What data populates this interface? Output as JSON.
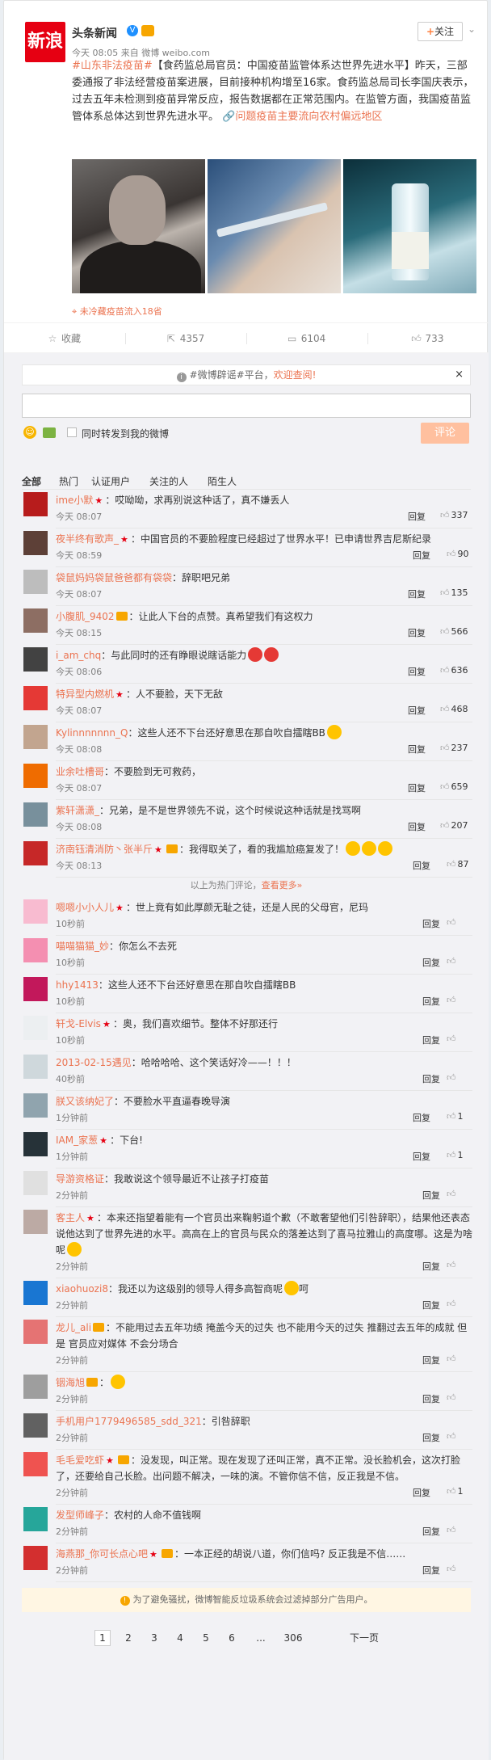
{
  "post": {
    "author": "头条新闻",
    "avatar_text": "新浪",
    "verified_icon": "V",
    "follow_plus": "+",
    "follow_label": "关注",
    "collapse_icon": "chevron-down-icon",
    "meta": "今天 08:05 来自 微博 weibo.com",
    "topic": "#山东非法疫苗#",
    "body": "【食药监总局官员：中国疫苗监管体系达世界先进水平】昨天，三部委通报了非法经营疫苗案进展，目前接种机构增至16家。食药监总局司长李国庆表示，过去五年未检测到疫苗异常反应，报告数据都在正常范围内。在监管方面，我国疫苗监管体系总体达到世界先进水平。",
    "link_icon": "link-icon",
    "link_text": "问题疫苗主要流向农村偏远地区",
    "location": "未冷藏疫苗流入18省"
  },
  "actions": {
    "collect": "收藏",
    "repost": "4357",
    "comment": "6104",
    "like": "733"
  },
  "comment_panel": {
    "notice_prefix": "#微博辟谣#平台，",
    "notice_link": "欢迎查阅!",
    "notice_close": "×",
    "emoji_icon": "smile-icon",
    "picture_icon": "picture-icon",
    "repost_check_label": "同时转发到我的微博",
    "post_button": "评论",
    "tabs": [
      "全部",
      "热门",
      "认证用户",
      "关注的人",
      "陌生人"
    ]
  },
  "comments": [
    {
      "user": "ime小默",
      "badges": "vip",
      "text": "：哎呦呦，求再别说这种话了，真不嫌丢人",
      "time": "今天 08:07",
      "reply": "回复",
      "likes": "337"
    },
    {
      "user": "夜半终有歌声_",
      "badges": "vip",
      "text": "：中国官员的不要脸程度已经超过了世界水平！已申请世界吉尼斯纪录",
      "time": "今天 08:59",
      "reply": "回复",
      "likes": "90"
    },
    {
      "user": "袋鼠妈妈袋鼠爸爸都有袋袋",
      "badges": "",
      "text": "：辞职吧兄弟",
      "time": "今天 08:07",
      "reply": "回复",
      "likes": "135"
    },
    {
      "user": "小腹肌_9402",
      "badges": "lv",
      "text": "：让此人下台的点赞。真希望我们有这权力",
      "time": "今天 08:15",
      "reply": "回复",
      "likes": "566"
    },
    {
      "user": "i_am_chq",
      "badges": "",
      "text": "：与此同时的还有睁眼说瞎话能力",
      "time": "今天 08:06",
      "reply": "回复",
      "likes": "636",
      "emoji": "red2"
    },
    {
      "user": "特异型内燃机",
      "badges": "vip",
      "text": "：人不要脸，天下无敌",
      "time": "今天 08:07",
      "reply": "回复",
      "likes": "468"
    },
    {
      "user": "Kylinnnnnnn_Q",
      "badges": "",
      "text": "：这些人还不下台还好意思在那自吹自擂瞎BB",
      "time": "今天 08:08",
      "reply": "回复",
      "likes": "237",
      "emoji": "one"
    },
    {
      "user": "业余吐槽哥",
      "badges": "",
      "text": "：不要脸到无可救药，",
      "time": "今天 08:07",
      "reply": "回复",
      "likes": "659"
    },
    {
      "user": "紫轩潇潇_",
      "badges": "",
      "text": "：兄弟，是不是世界领先不说，这个时候说这种话就是找骂啊",
      "time": "今天 08:08",
      "reply": "回复",
      "likes": "207"
    },
    {
      "user": "济南钰清消防丶张半斤",
      "badges": "vlv",
      "text": "：我得取关了，看的我尴尬癌复发了！",
      "time": "今天 08:13",
      "reply": "回复",
      "likes": "87",
      "emoji": "three"
    }
  ],
  "hot_note": {
    "prefix": "以上为热门评论，",
    "more": "查看更多»"
  },
  "latest": [
    {
      "user": "嗯嗯小小人儿",
      "badges": "vip",
      "text": "：世上竟有如此厚颜无耻之徒，还是人民的父母官，尼玛",
      "time": "10秒前",
      "reply": "回复",
      "likes": ""
    },
    {
      "user": "喵喵猫猫_妙",
      "badges": "",
      "text": "：你怎么不去死",
      "time": "10秒前",
      "reply": "回复",
      "likes": ""
    },
    {
      "user": "hhy1413",
      "badges": "",
      "text": "：这些人还不下台还好意思在那自吹自擂瞎BB",
      "time": "10秒前",
      "reply": "回复",
      "likes": ""
    },
    {
      "user": "轩戈-Elvis",
      "badges": "vip",
      "text": "：奥，我们喜欢细节。整体不好那还行",
      "time": "10秒前",
      "reply": "回复",
      "likes": ""
    },
    {
      "user": "2013-02-15遇见",
      "badges": "",
      "text": "：哈哈哈哈、这个笑话好冷——！！！",
      "time": "40秒前",
      "reply": "回复",
      "likes": ""
    },
    {
      "user": "朕又该纳妃了",
      "badges": "",
      "text": "：不要脸水平直逼春晚导演",
      "time": "1分钟前",
      "reply": "回复",
      "likes": "1"
    },
    {
      "user": "IAM_家葱",
      "badges": "vip",
      "text": "：下台!",
      "time": "1分钟前",
      "reply": "回复",
      "likes": "1"
    },
    {
      "user": "导游资格证",
      "badges": "",
      "text": "：我敢说这个领导最近不让孩子打疫苗",
      "time": "2分钟前",
      "reply": "回复",
      "likes": ""
    },
    {
      "user": "客主人",
      "badges": "vip",
      "text": "：本来还指望着能有一个官员出来鞠躬道个歉（不敢奢望他们引咎辞职），结果他还表态说他达到了世界先进的水平。高高在上的官员与民众的落差达到了喜马拉雅山的高度哪。这是为啥呢",
      "time": "2分钟前",
      "reply": "回复",
      "likes": "",
      "emoji": "one"
    },
    {
      "user": "xiaohuozi8",
      "badges": "",
      "text": "：我还以为这级别的领导人得多高智商呢",
      "text2": "呵",
      "time": "2分钟前",
      "reply": "回复",
      "likes": "",
      "emoji": "one"
    },
    {
      "user": "龙儿_ali",
      "badges": "lv",
      "text": "：不能用过去五年功绩 掩盖今天的过失 也不能用今天的过失 推翻过去五年的成就 但是 官员应对媒体 不会分场合",
      "time": "2分钟前",
      "reply": "回复",
      "likes": ""
    },
    {
      "user": "铟海旭",
      "badges": "lv",
      "text": "：",
      "time": "2分钟前",
      "reply": "回复",
      "likes": "",
      "emoji": "one"
    },
    {
      "user": "手机用户1779496585_sdd_321",
      "badges": "",
      "text": "：引咎辞职",
      "time": "2分钟前",
      "reply": "回复",
      "likes": ""
    },
    {
      "user": "毛毛爱吃虾",
      "badges": "vlv",
      "text": "：没发现，叫正常。现在发现了还叫正常，真不正常。没长脸机会，这次打脸了，还要给自己长脸。出问题不解决，一味的演。不管你信不信，反正我是不信。",
      "time": "2分钟前",
      "reply": "回复",
      "likes": "1"
    },
    {
      "user": "发型师峰子",
      "badges": "",
      "text": "：农村的人命不值钱啊",
      "time": "2分钟前",
      "reply": "回复",
      "likes": ""
    },
    {
      "user": "海燕那_你可长点心吧",
      "badges": "vlv",
      "text": "：一本正经的胡说八道，你们信吗? 反正我是不信……",
      "time": "2分钟前",
      "reply": "回复",
      "likes": ""
    }
  ],
  "ad_notice": "为了避免骚扰，微博智能反垃圾系统会过滤掉部分广告用户。",
  "pager": {
    "pages": [
      "1",
      "2",
      "3",
      "4",
      "5",
      "6",
      "...",
      "306"
    ],
    "next": "下一页"
  },
  "colors": {
    "accent": "#eb7350",
    "panel": "#f2f2f5",
    "button_disabled": "#ffc09f"
  }
}
